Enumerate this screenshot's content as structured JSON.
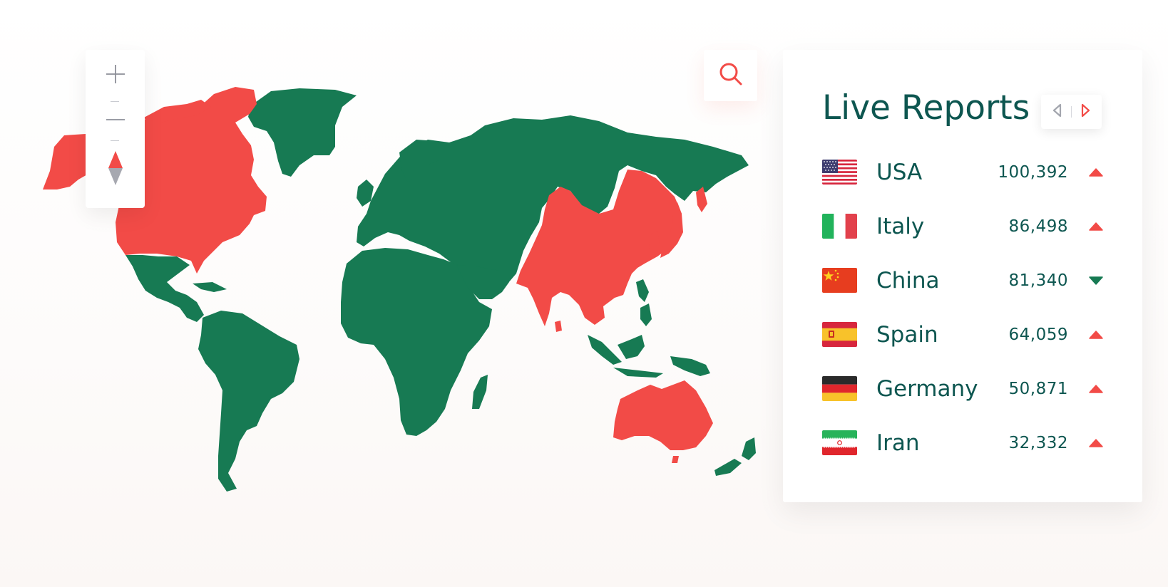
{
  "map": {
    "colors": {
      "reported": "#f24b47",
      "other": "#177a53"
    },
    "highlighted_regions": [
      "North America",
      "Greenland",
      "China",
      "Southeast Asia",
      "Australia"
    ]
  },
  "map_controls": {
    "zoom_in_icon": "plus-icon",
    "zoom_out_icon": "minus-icon",
    "compass_icon": "compass-icon"
  },
  "search": {
    "icon": "search-icon",
    "accent": "#f24b47"
  },
  "panel": {
    "title": "Live Reports",
    "pager": {
      "prev_icon": "chevron-left-icon",
      "next_icon": "chevron-right-icon"
    },
    "rows": [
      {
        "country": "USA",
        "value": "100,392",
        "trend": "up",
        "flag": "usa-flag-icon"
      },
      {
        "country": "Italy",
        "value": "86,498",
        "trend": "up",
        "flag": "italy-flag-icon"
      },
      {
        "country": "China",
        "value": "81,340",
        "trend": "down",
        "flag": "china-flag-icon"
      },
      {
        "country": "Spain",
        "value": "64,059",
        "trend": "up",
        "flag": "spain-flag-icon"
      },
      {
        "country": "Germany",
        "value": "50,871",
        "trend": "up",
        "flag": "germany-flag-icon"
      },
      {
        "country": "Iran",
        "value": "32,332",
        "trend": "up",
        "flag": "iran-flag-icon"
      }
    ],
    "colors": {
      "title": "#0d5650",
      "up": "#f24b47",
      "down": "#177a53"
    }
  }
}
